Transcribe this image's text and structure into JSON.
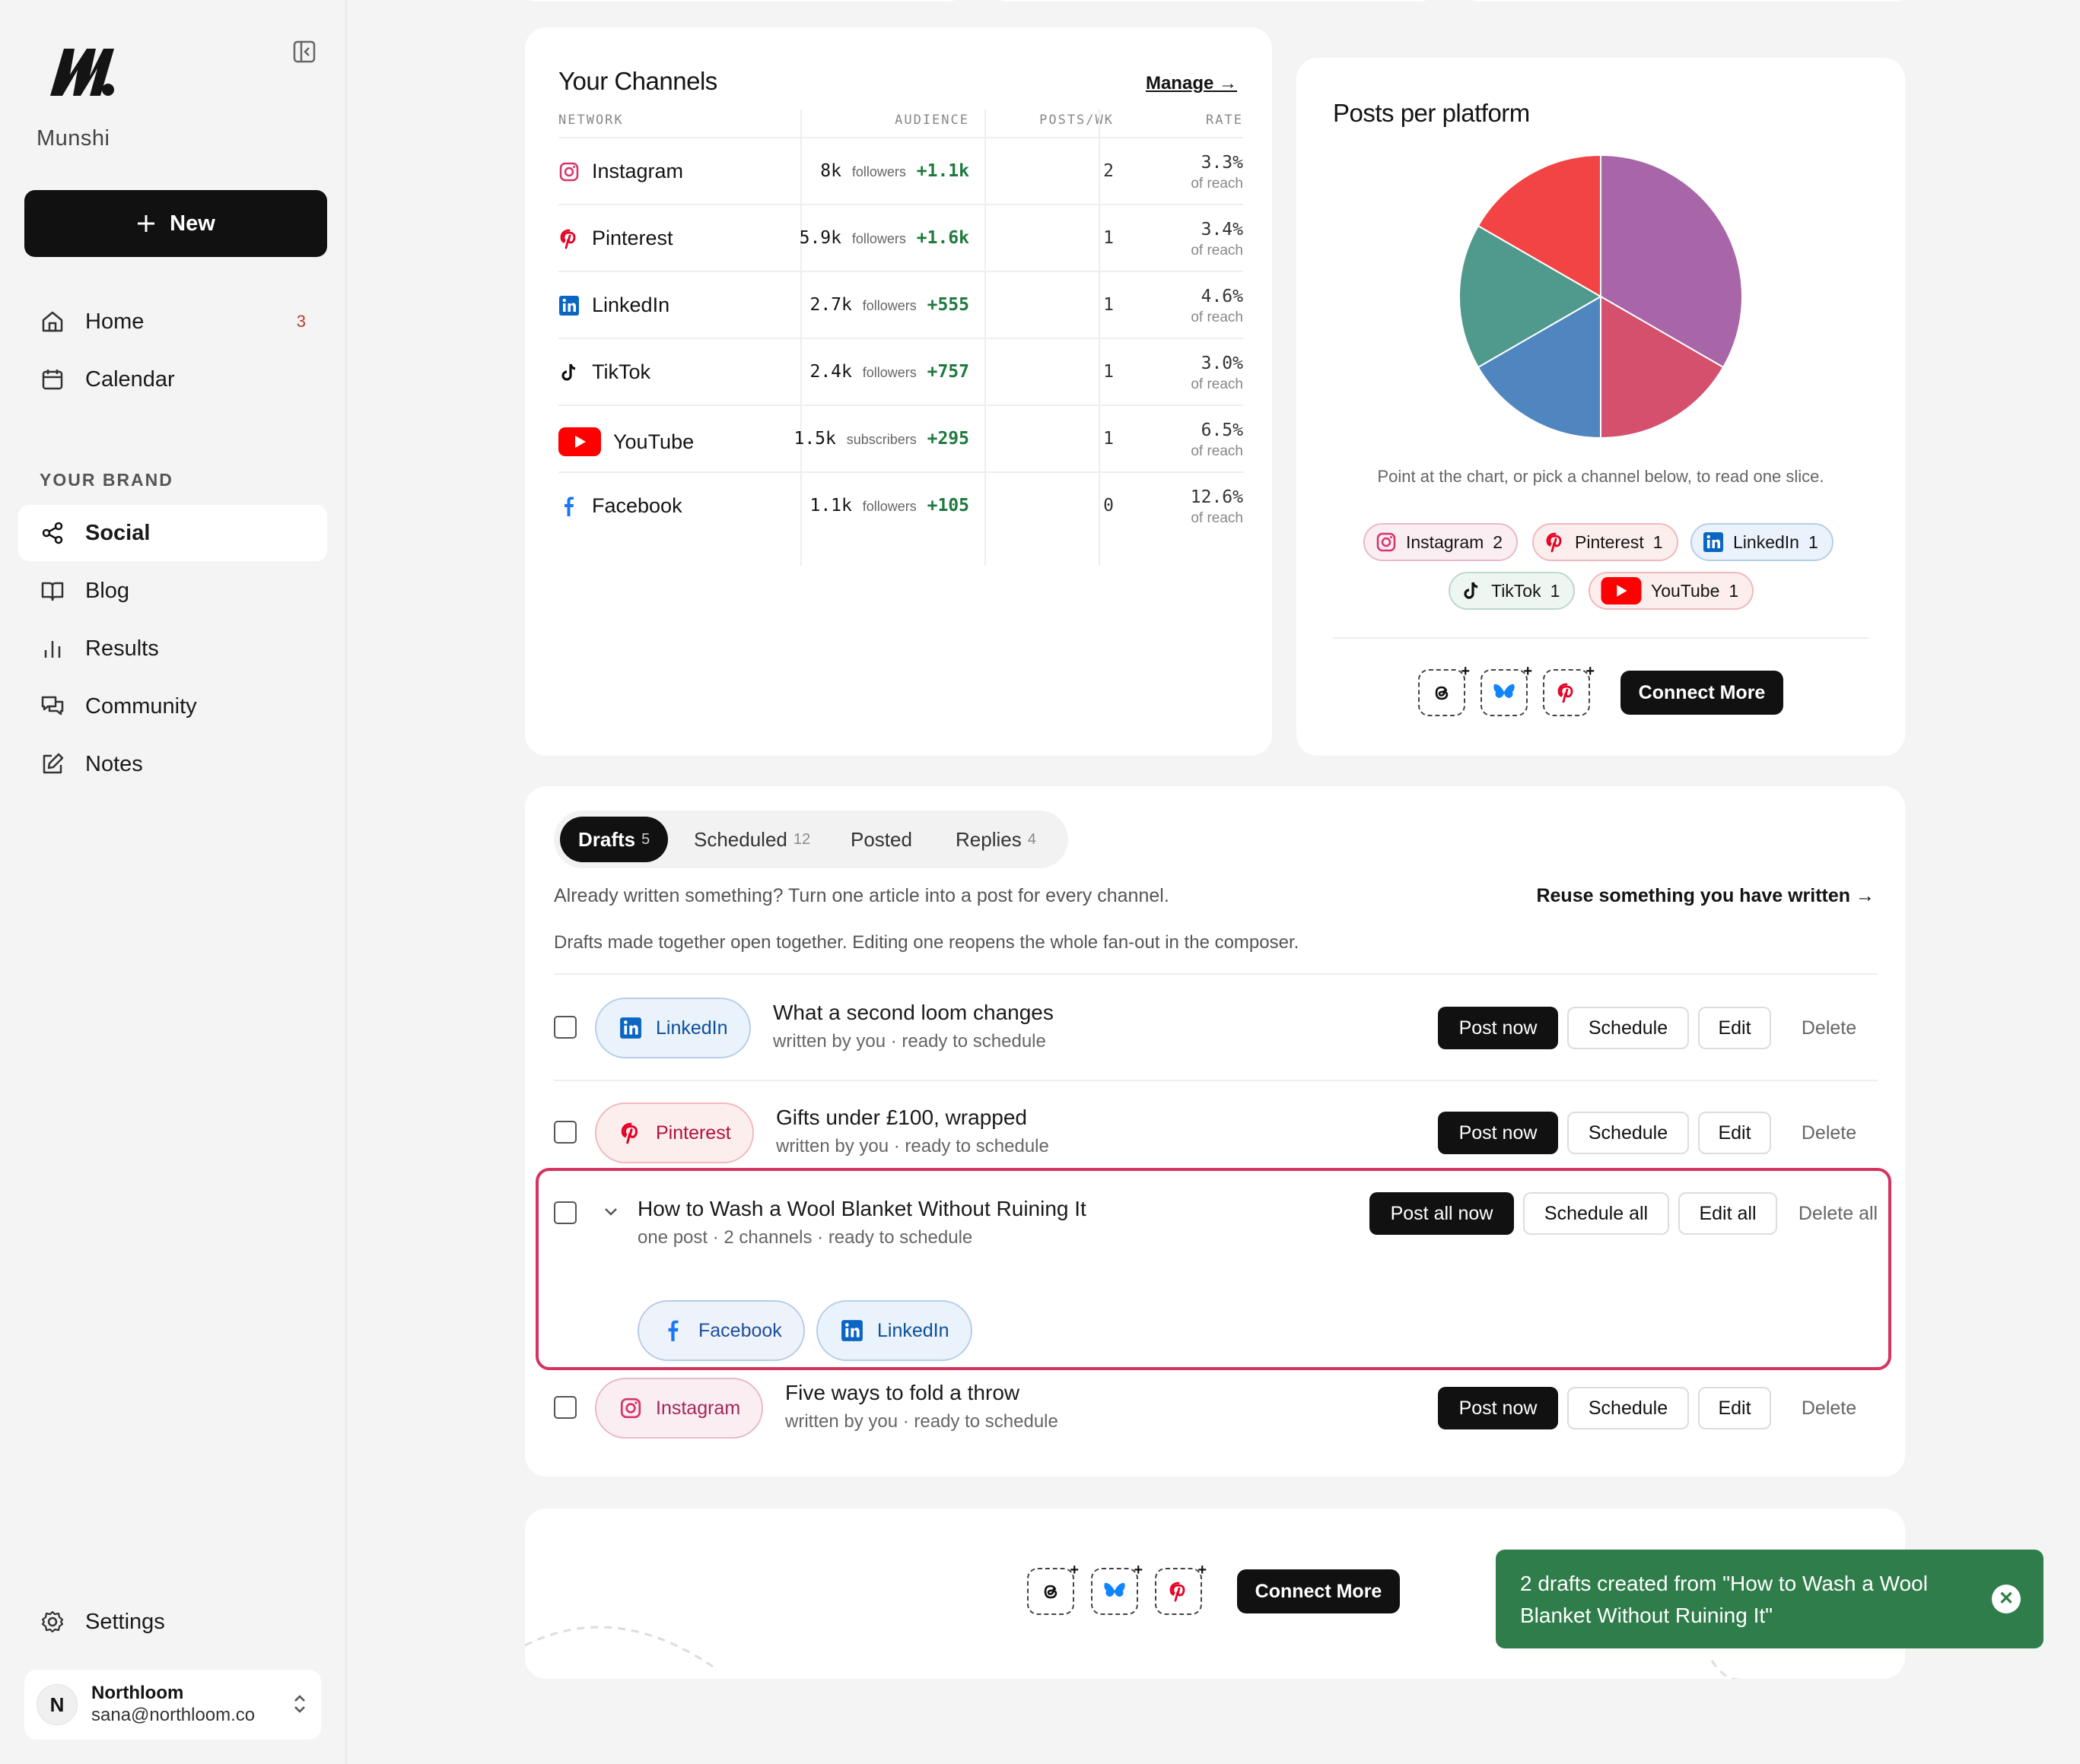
{
  "sidebar": {
    "brand": "Munshi",
    "new_button": "New",
    "nav": [
      {
        "label": "Home",
        "badge": "3"
      },
      {
        "label": "Calendar"
      }
    ],
    "section_label": "YOUR BRAND",
    "brand_nav": [
      {
        "label": "Social",
        "active": true
      },
      {
        "label": "Blog"
      },
      {
        "label": "Results"
      },
      {
        "label": "Community"
      },
      {
        "label": "Notes"
      }
    ],
    "settings": "Settings",
    "account": {
      "initial": "N",
      "name": "Northloom",
      "email": "sana@northloom.co"
    }
  },
  "channels": {
    "title": "Your Channels",
    "manage": "Manage →",
    "headers": {
      "network": "NETWORK",
      "audience": "AUDIENCE",
      "posts": "POSTS/WK",
      "rate": "RATE"
    },
    "rows": [
      {
        "network": "Instagram",
        "audience": "8k",
        "unit": "followers",
        "gain": "+1.1k",
        "posts": "2",
        "rate": "3.3%",
        "rate_note": "of reach"
      },
      {
        "network": "Pinterest",
        "audience": "5.9k",
        "unit": "followers",
        "gain": "+1.6k",
        "posts": "1",
        "rate": "3.4%",
        "rate_note": "of reach"
      },
      {
        "network": "LinkedIn",
        "audience": "2.7k",
        "unit": "followers",
        "gain": "+555",
        "posts": "1",
        "rate": "4.6%",
        "rate_note": "of reach"
      },
      {
        "network": "TikTok",
        "audience": "2.4k",
        "unit": "followers",
        "gain": "+757",
        "posts": "1",
        "rate": "3.0%",
        "rate_note": "of reach"
      },
      {
        "network": "YouTube",
        "audience": "1.5k",
        "unit": "subscribers",
        "gain": "+295",
        "posts": "1",
        "rate": "6.5%",
        "rate_note": "of reach"
      },
      {
        "network": "Facebook",
        "audience": "1.1k",
        "unit": "followers",
        "gain": "+105",
        "posts": "0",
        "rate": "12.6%",
        "rate_note": "of reach"
      }
    ]
  },
  "platforms": {
    "title": "Posts per platform",
    "hint": "Point at the chart, or pick a channel below, to read one slice.",
    "chips": [
      {
        "label": "Instagram",
        "count": "2"
      },
      {
        "label": "Pinterest",
        "count": "1"
      },
      {
        "label": "LinkedIn",
        "count": "1"
      },
      {
        "label": "TikTok",
        "count": "1"
      },
      {
        "label": "YouTube",
        "count": "1"
      }
    ],
    "connect_more": "Connect More"
  },
  "chart_data": {
    "type": "pie",
    "categories": [
      "Instagram",
      "Pinterest",
      "LinkedIn",
      "TikTok",
      "YouTube"
    ],
    "values": [
      2,
      1,
      1,
      1,
      1
    ],
    "colors": [
      "#a865a8",
      "#d4506c",
      "#4f86c0",
      "#4f9a8c",
      "#f24444"
    ]
  },
  "drafts": {
    "tabs": [
      {
        "label": "Drafts",
        "count": "5",
        "active": true
      },
      {
        "label": "Scheduled",
        "count": "12"
      },
      {
        "label": "Posted",
        "count": ""
      },
      {
        "label": "Replies",
        "count": "4"
      }
    ],
    "reuse_text": "Already written something? Turn one article into a post for every channel.",
    "reuse_link": "Reuse something you have written →",
    "fan_note": "Drafts made together open together. Editing one reopens the whole fan-out in the composer.",
    "items": [
      {
        "channel": "LinkedIn",
        "title": "What a second loom changes",
        "meta": "written by you · ready to schedule"
      },
      {
        "channel": "Pinterest",
        "title": "Gifts under £100, wrapped",
        "meta": "written by you · ready to schedule"
      },
      {
        "channel": "Instagram",
        "title": "Five ways to fold a throw",
        "meta": "written by you · ready to schedule"
      }
    ],
    "group": {
      "title": "How to Wash a Wool Blanket Without Ruining It",
      "meta": "one post · 2 channels · ready to schedule",
      "channels": [
        "Facebook",
        "LinkedIn"
      ],
      "post_all": "Post all now",
      "schedule_all": "Schedule all",
      "edit_all": "Edit all",
      "delete_all": "Delete all"
    },
    "actions": {
      "post": "Post now",
      "schedule": "Schedule",
      "edit": "Edit",
      "delete": "Delete"
    }
  },
  "bottom": {
    "connect_more": "Connect More"
  },
  "toast": {
    "message": "2 drafts created from \"How to Wash a Wool Blanket Without Ruining It\""
  }
}
